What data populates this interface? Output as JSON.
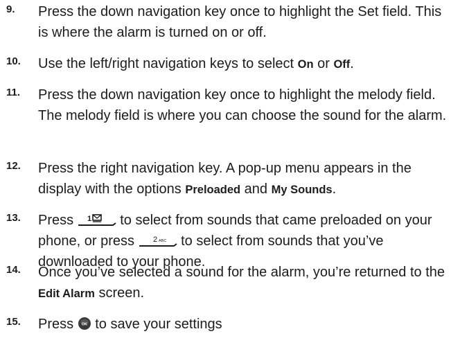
{
  "steps": [
    {
      "number": "9.",
      "text": "Press the down navigation key once to highlight the Set field. This is where the alarm is turned on or off."
    },
    {
      "number": "10.",
      "before": "Use the left/right navigation keys to select ",
      "bold1": "On",
      "middle": " or ",
      "bold2": "Off",
      "after": "."
    },
    {
      "number": "11.",
      "text": "Press the down navigation key once to highlight the melody field. The melody field is where you can choose the sound for the alarm."
    },
    {
      "number": "12.",
      "before": "Press the right navigation key. A pop-up menu appears in the display with the options ",
      "bold1": "Preloaded",
      "middle": " and ",
      "bold2": "My Sounds",
      "after": "."
    },
    {
      "number": "13.",
      "part1": "Press ",
      "part2": " to select from sounds that came preloaded on your phone, or press ",
      "part3": " to select from sounds that you’ve downloaded to your phone.",
      "key1_label": "1",
      "key2_label": "2",
      "key2_letters": "ABC"
    },
    {
      "number": "14.",
      "before": "Once you’ve selected a sound for the alarm, you’re returned to the ",
      "bold1": "Edit Alarm",
      "after": " screen."
    },
    {
      "number": "15.",
      "before": "Press ",
      "after": " to save your settings",
      "ok_label": "OK"
    }
  ]
}
